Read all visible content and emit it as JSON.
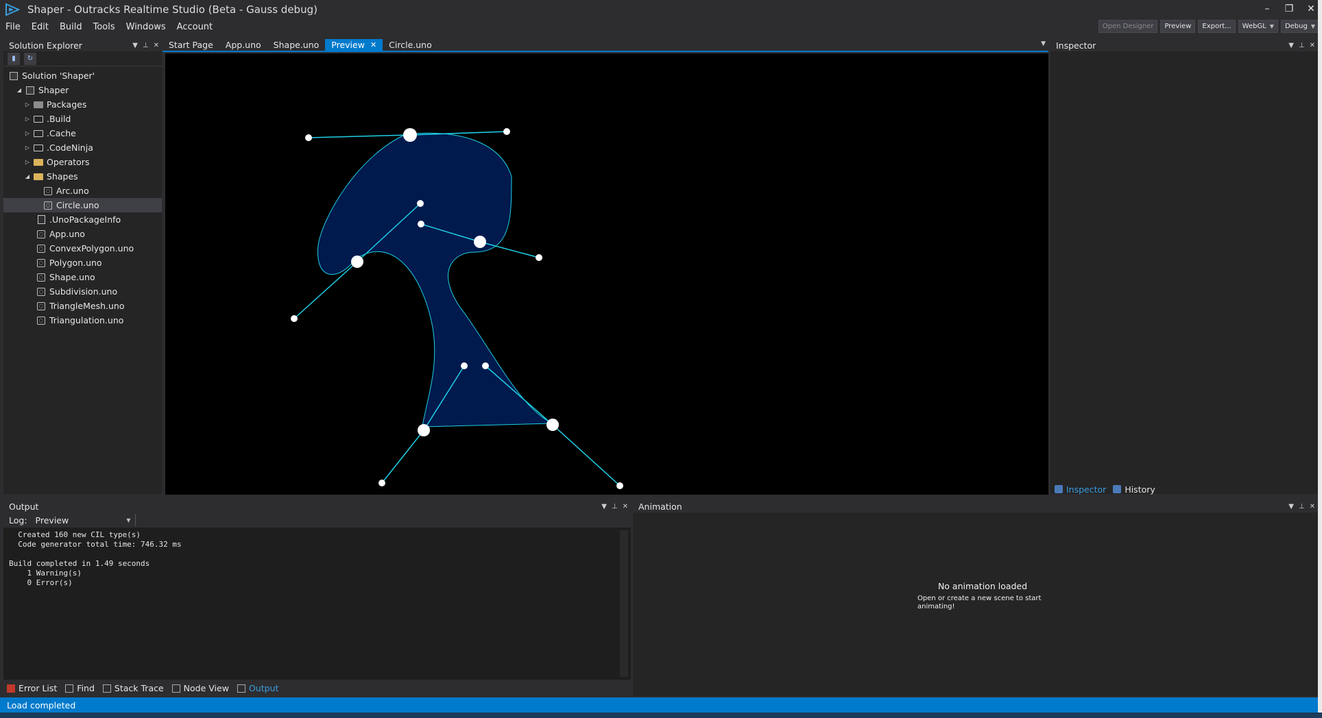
{
  "window": {
    "title": "Shaper - Outracks Realtime Studio (Beta - Gauss debug)",
    "controls": {
      "minimize": "–",
      "restore": "❐",
      "close": "✕"
    }
  },
  "menu": [
    "File",
    "Edit",
    "Build",
    "Tools",
    "Windows",
    "Account"
  ],
  "toolbar": {
    "open_designer": "Open Designer",
    "preview": "Preview",
    "export": "Export...",
    "target": "WebGL",
    "config": "Debug"
  },
  "solution_explorer": {
    "title": "Solution Explorer",
    "root": "Solution 'Shaper'",
    "project": "Shaper",
    "folders": [
      "Packages",
      ".Build",
      ".Cache",
      ".CodeNinja",
      "Operators",
      "Shapes"
    ],
    "shapes_children": [
      "Arc.uno",
      "Circle.uno"
    ],
    "files": [
      ".UnoPackageInfo",
      "App.uno",
      "ConvexPolygon.uno",
      "Polygon.uno",
      "Shape.uno",
      "Subdivision.uno",
      "TriangleMesh.uno",
      "Triangulation.uno"
    ]
  },
  "editor": {
    "tabs": [
      "Start Page",
      "App.uno",
      "Shape.uno",
      "Preview",
      "Circle.uno"
    ],
    "active_tab": "Preview"
  },
  "inspector": {
    "title": "Inspector",
    "tabs": [
      "Inspector",
      "History"
    ]
  },
  "output": {
    "title": "Output",
    "log_label": "Log:",
    "log_source": "Preview",
    "lines": [
      "  Created 160 new CIL type(s)",
      "  Code generator total time: 746.32 ms",
      "",
      "Build completed in 1.49 seconds",
      "    1 Warning(s)",
      "    0 Error(s)"
    ]
  },
  "animation": {
    "title": "Animation",
    "empty_title": "No animation loaded",
    "empty_sub": "Open or create a new scene to start animating!"
  },
  "bottom_tabs": [
    "Error List",
    "Find",
    "Stack Trace",
    "Node View",
    "Output"
  ],
  "status": "Load completed",
  "colors": {
    "accent": "#007acc",
    "shape_fill": "#001a4d",
    "handle_line": "#1fd0e6"
  }
}
